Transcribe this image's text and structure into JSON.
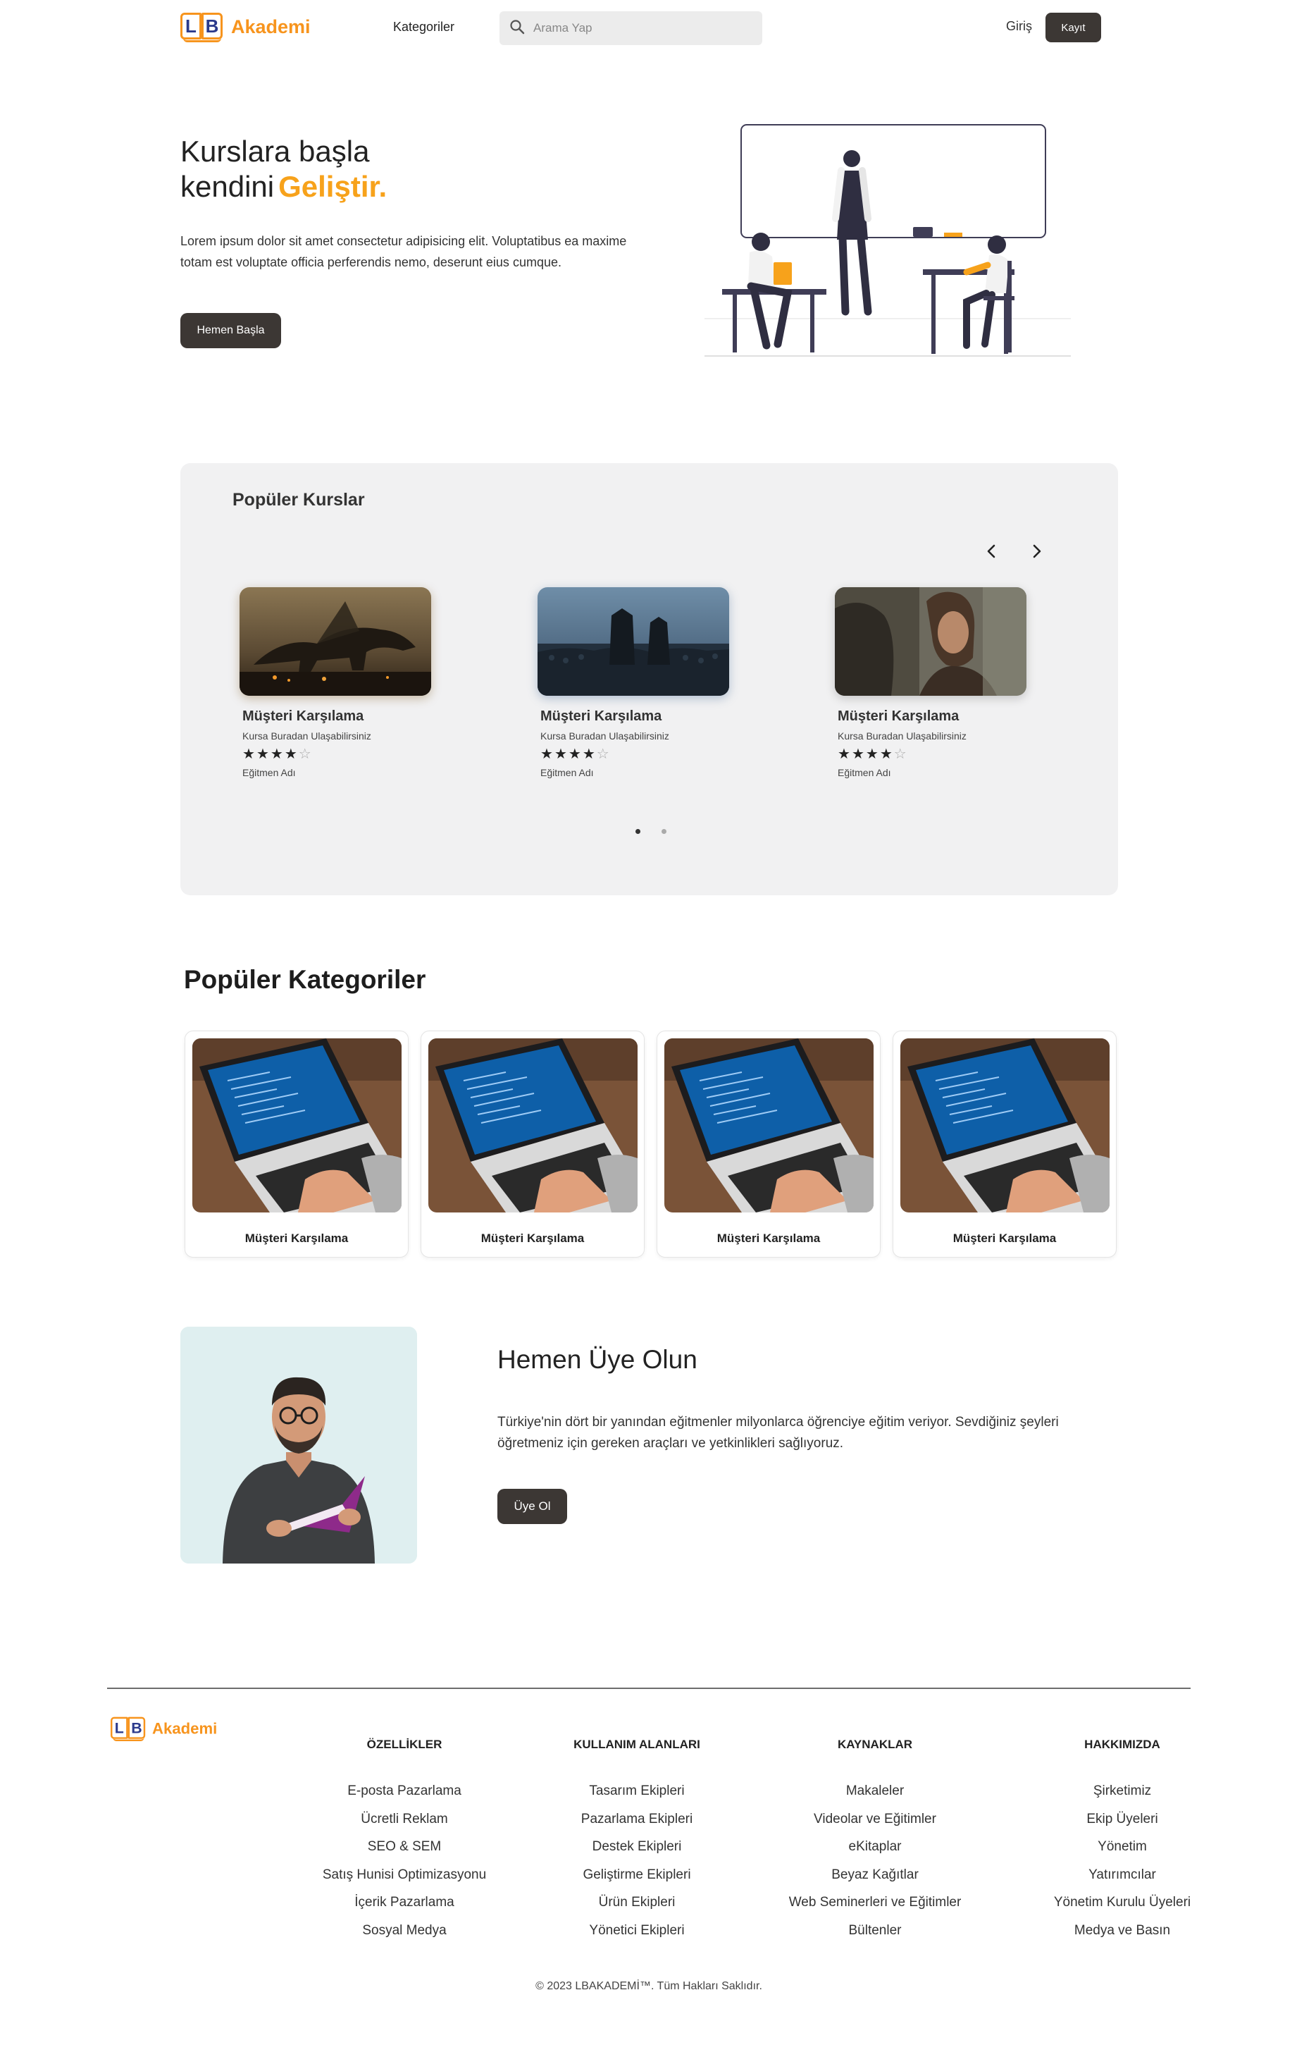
{
  "header": {
    "logo_letters": [
      "L",
      "B"
    ],
    "logo_text": "Akademi",
    "nav_categories": "Kategoriler",
    "search_placeholder": "Arama Yap",
    "login_label": "Giriş",
    "signup_label": "Kayıt"
  },
  "hero": {
    "title_line1": "Kurslara başla",
    "title_line2": "kendini",
    "title_accent": "Geliştir.",
    "description": "Lorem ipsum dolor sit amet consectetur adipisicing elit. Voluptatibus ea maxime totam est voluptate officia perferendis nemo, deserunt eius cumque.",
    "cta_label": "Hemen Başla"
  },
  "popular_courses": {
    "title": "Popüler Kurslar",
    "courses": [
      {
        "name": "Müşteri Karşılama",
        "subtitle": "Kursa Buradan Ulaşabilirsiniz",
        "rating": 4,
        "max_rating": 5,
        "instructor": "Eğitmen Adı",
        "image": "dragon-scene"
      },
      {
        "name": "Müşteri Karşılama",
        "subtitle": "Kursa Buradan Ulaşabilirsiniz",
        "rating": 4,
        "max_rating": 5,
        "instructor": "Eğitmen Adı",
        "image": "army-scene"
      },
      {
        "name": "Müşteri Karşılama",
        "subtitle": "Kursa Buradan Ulaşabilirsiniz",
        "rating": 4,
        "max_rating": 5,
        "instructor": "Eğitmen Adı",
        "image": "portrait-scene"
      }
    ],
    "pagination": {
      "pages": 2,
      "active": 1
    }
  },
  "popular_categories": {
    "title": "Popüler Kategoriler",
    "items": [
      {
        "name": "Müşteri Karşılama"
      },
      {
        "name": "Müşteri Karşılama"
      },
      {
        "name": "Müşteri Karşılama"
      },
      {
        "name": "Müşteri Karşılama"
      }
    ]
  },
  "join": {
    "title": "Hemen Üye Olun",
    "description": "Türkiye'nin dört bir yanından eğitmenler milyonlarca öğrenciye eğitim veriyor. Sevdiğiniz şeyleri öğretmeniz için gereken araçları ve yetkinlikleri sağlıyoruz.",
    "cta_label": "Üye Ol"
  },
  "footer": {
    "columns": [
      {
        "title": "ÖZELLİKLER",
        "links": [
          "E-posta Pazarlama",
          "Ücretli Reklam",
          "SEO & SEM",
          "Satış Hunisi Optimizasyonu",
          "İçerik Pazarlama",
          "Sosyal Medya"
        ]
      },
      {
        "title": "KULLANIM ALANLARI",
        "links": [
          "Tasarım Ekipleri",
          "Pazarlama Ekipleri",
          "Destek Ekipleri",
          "Geliştirme Ekipleri",
          "Ürün Ekipleri",
          "Yönetici Ekipleri"
        ]
      },
      {
        "title": "KAYNAKLAR",
        "links": [
          "Makaleler",
          "Videolar ve Eğitimler",
          "eKitaplar",
          "Beyaz Kağıtlar",
          "Web Seminerleri ve Eğitimler",
          "Bültenler"
        ]
      },
      {
        "title": "HAKKIMIZDA",
        "links": [
          "Şirketimiz",
          "Ekip Üyeleri",
          "Yönetim",
          "Yatırımcılar",
          "Yönetim Kurulu Üyeleri",
          "Medya ve Basın"
        ]
      }
    ],
    "copyright": "© 2023 LBAKADEMİ™. Tüm Hakları Saklıdır."
  },
  "colors": {
    "accent": "#f7a21b",
    "brand_orange": "#f7941d",
    "dark_button": "#3c3734",
    "panel_bg": "#f1f1f2"
  }
}
